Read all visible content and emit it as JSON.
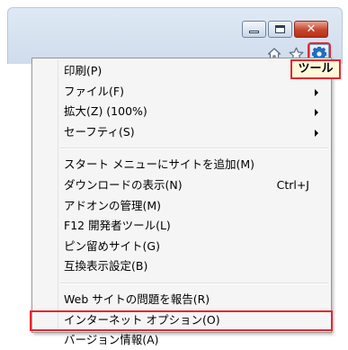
{
  "window_controls": {
    "minimize_icon": "minimize-icon",
    "maximize_icon": "maximize-icon",
    "close_glyph": "✕"
  },
  "toolbar": {
    "icons": [
      "home-icon",
      "favorites-star-icon",
      "tools-gear-icon"
    ]
  },
  "callout": {
    "label": "ツール"
  },
  "menu": {
    "groups": [
      [
        {
          "label": "印刷(P)",
          "submenu": false
        },
        {
          "label": "ファイル(F)",
          "submenu": true
        },
        {
          "label": "拡大(Z) (100%)",
          "submenu": true
        },
        {
          "label": "セーフティ(S)",
          "submenu": true
        }
      ],
      [
        {
          "label": "スタート メニューにサイトを追加(M)",
          "submenu": false
        },
        {
          "label": "ダウンロードの表示(N)",
          "submenu": false,
          "shortcut": "Ctrl+J"
        },
        {
          "label": "アドオンの管理(M)",
          "submenu": false
        },
        {
          "label": "F12 開発者ツール(L)",
          "submenu": false
        },
        {
          "label": "ピン留めサイト(G)",
          "submenu": false
        },
        {
          "label": "互換表示設定(B)",
          "submenu": false
        }
      ],
      [
        {
          "label": "Web サイトの問題を報告(R)",
          "submenu": false
        },
        {
          "label": "インターネット オプション(O)",
          "submenu": false,
          "highlighted": true
        },
        {
          "label": "バージョン情報(A)",
          "submenu": false
        }
      ]
    ]
  },
  "colors": {
    "highlight_border": "#e8262d",
    "callout_background": "#fff8d8",
    "menu_background": "#f5f5f5"
  }
}
